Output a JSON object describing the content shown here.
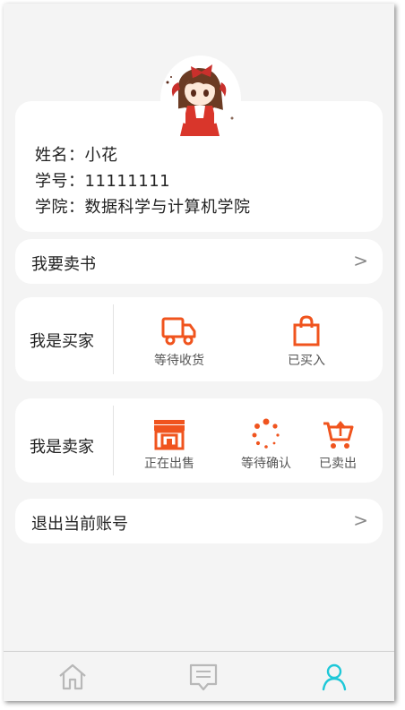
{
  "profile": {
    "name_line": "姓名：小花",
    "id_line": "学号：11111111",
    "college_line": "学院：数据科学与计算机学院"
  },
  "sell_book": {
    "label": "我要卖书",
    "arrow": ">"
  },
  "buyer": {
    "title": "我是买家",
    "actions": [
      {
        "label": "等待收货",
        "icon": "truck-icon"
      },
      {
        "label": "已买入",
        "icon": "shopping-bag-icon"
      }
    ]
  },
  "seller": {
    "title": "我是卖家",
    "actions": [
      {
        "label": "正在出售",
        "icon": "storefront-icon"
      },
      {
        "label": "等待确认",
        "icon": "loading-dots-icon"
      },
      {
        "label": "已卖出",
        "icon": "cart-upload-icon"
      }
    ]
  },
  "logout": {
    "label": "退出当前账号",
    "arrow": ">"
  },
  "tabs": [
    {
      "icon": "home-icon",
      "active": false
    },
    {
      "icon": "message-icon",
      "active": false
    },
    {
      "icon": "user-icon",
      "active": true
    }
  ],
  "colors": {
    "accent": "#f0541e",
    "active_tab": "#1ec8d8",
    "inactive_tab": "#b8b8b8"
  }
}
